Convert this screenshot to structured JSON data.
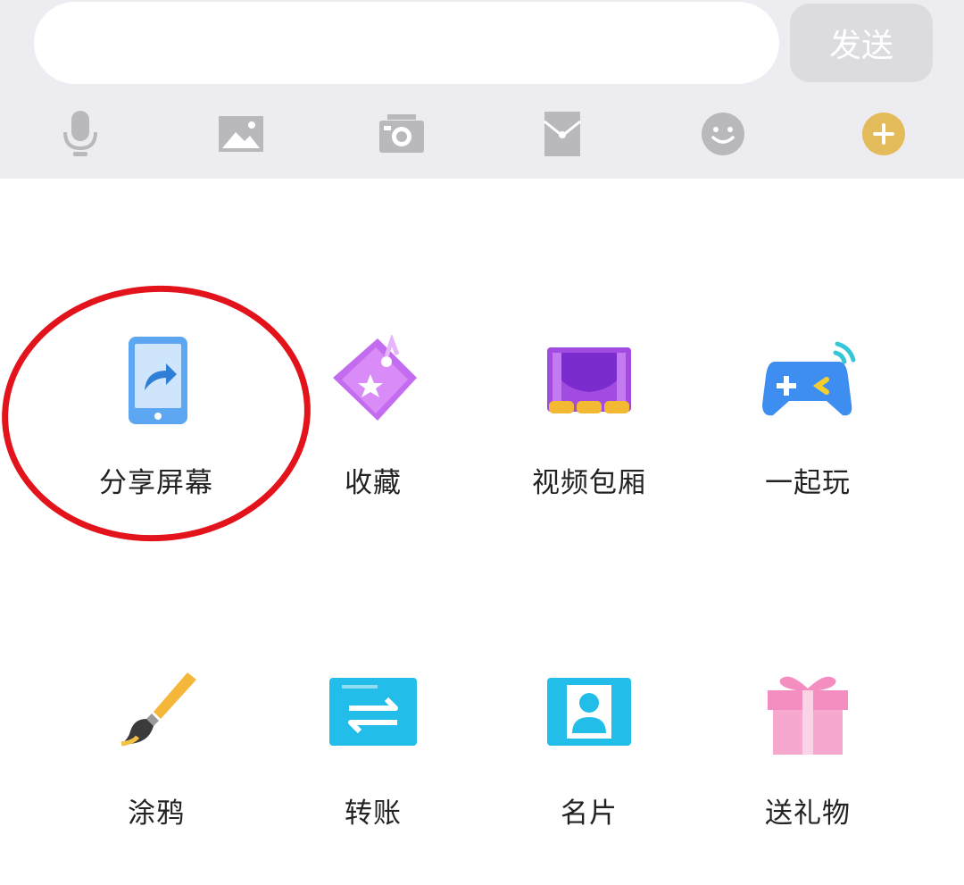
{
  "input_bar": {
    "input_value": "",
    "input_placeholder": "",
    "send_label": "发送",
    "toolbar": [
      {
        "icon": "microphone-icon"
      },
      {
        "icon": "image-icon"
      },
      {
        "icon": "camera-icon"
      },
      {
        "icon": "red-envelope-icon"
      },
      {
        "icon": "emoji-icon"
      },
      {
        "icon": "plus-icon"
      }
    ]
  },
  "panel": {
    "items": [
      {
        "label": "分享屏幕",
        "icon": "share-screen-icon"
      },
      {
        "label": "收藏",
        "icon": "favorites-icon"
      },
      {
        "label": "视频包厢",
        "icon": "video-theater-icon"
      },
      {
        "label": "一起玩",
        "icon": "gamepad-icon"
      },
      {
        "label": "涂鸦",
        "icon": "paintbrush-icon"
      },
      {
        "label": "转账",
        "icon": "transfer-icon"
      },
      {
        "label": "名片",
        "icon": "contact-card-icon"
      },
      {
        "label": "送礼物",
        "icon": "gift-icon"
      }
    ]
  },
  "colors": {
    "toolbar_bg": "#ededf1",
    "icon_gray": "#b9b9bd",
    "plus_accent": "#e3bb5b",
    "highlight_circle": "#e3131b"
  }
}
